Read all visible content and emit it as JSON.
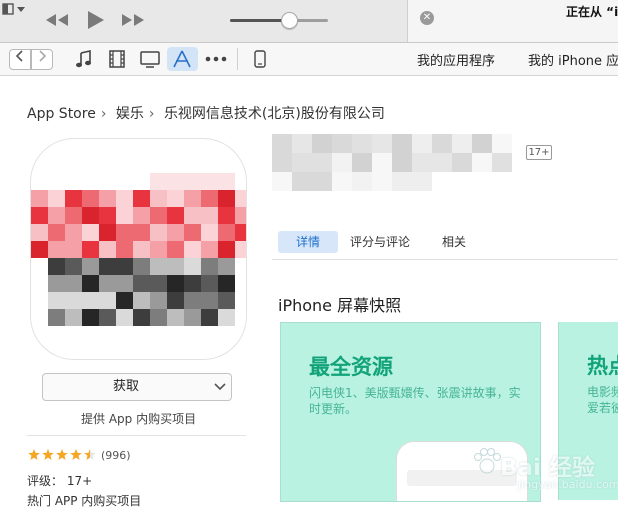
{
  "player": {
    "controls": [
      "rewind-icon",
      "play-icon",
      "fast-forward-icon"
    ],
    "volume_level": 0.6,
    "status_text": "正在从 “iT"
  },
  "toolbar": {
    "media_icons": [
      "music-icon",
      "movie-icon",
      "tv-icon",
      "app-store-icon",
      "more-icon",
      "iphone-device-icon"
    ],
    "tabs": [
      "我的应用程序",
      "我的 iPhone 应"
    ]
  },
  "breadcrumb": [
    "App Store",
    "娱乐",
    "乐视网信息技术(北京)股份有限公司"
  ],
  "app": {
    "age_badge": "17+",
    "get_label": "获取",
    "iap_note": "提供 App 内购买项目",
    "rating_count": "(996)",
    "rating_value": 4.5,
    "age_label": "评级：",
    "age_value": "17+",
    "iap_row": "热门 APP 内购买项目"
  },
  "tabs": [
    "详情",
    "评分与评论",
    "相关"
  ],
  "screens_title": "iPhone 屏幕快照",
  "screenshots": [
    {
      "title": "最全资源",
      "subtitle": "闪电侠1、美版甄嬛传、张震讲故事，实时更新。"
    },
    {
      "title": "热点",
      "subtitle": "电影频道\n爱若彼"
    }
  ],
  "watermark": {
    "text": "Bai 经验",
    "sub": "jingyan.baidu.com"
  },
  "colors": {
    "accent": "#1e6fd0",
    "selected_tab_bg": "#d7e6f8",
    "screenshot_bg": "#b9f2e1",
    "screenshot_title": "#12a37a",
    "star": "#f5a623"
  }
}
